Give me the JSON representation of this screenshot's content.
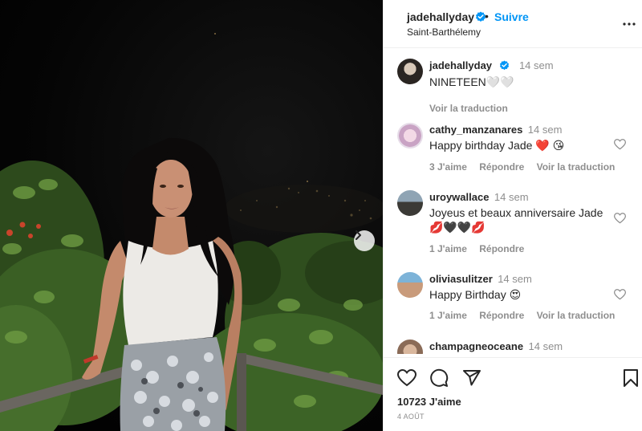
{
  "post": {
    "author": "jadehallyday",
    "follow_label": "Suivre",
    "separator": "•",
    "location": "Saint-Barthélemy",
    "likes": "10723 J'aime",
    "date": "4 AOÛT"
  },
  "caption": {
    "user": "jadehallyday",
    "time": "14 sem",
    "text": "NINETEEN🤍🤍",
    "see_translation": "Voir la traduction"
  },
  "comments": [
    {
      "user": "cathy_manzanares",
      "time": "14 sem",
      "text": "Happy birthday Jade ❤️ 😘",
      "text_line2": "",
      "likes": "3 J'aime",
      "reply": "Répondre",
      "translate": "Voir la traduction"
    },
    {
      "user": "uroywallace",
      "time": "14 sem",
      "text": "Joyeus et beaux anniversaire Jade",
      "text_line2": "💋🖤🖤💋",
      "likes": "1 J'aime",
      "reply": "Répondre",
      "translate": ""
    },
    {
      "user": "oliviasulitzer",
      "time": "14 sem",
      "text": "Happy Birthday 😍",
      "text_line2": "",
      "likes": "1 J'aime",
      "reply": "Répondre",
      "translate": "Voir la traduction"
    },
    {
      "user": "champagneoceane",
      "time": "14 sem",
      "text": "",
      "text_line2": "",
      "likes": "",
      "reply": "",
      "translate": ""
    }
  ],
  "icons": {
    "verified": "verified-badge-icon",
    "more": "more-options-icon",
    "next": "chevron-right-icon",
    "like": "heart-icon",
    "comment": "comment-icon",
    "share": "share-icon",
    "save": "bookmark-icon"
  },
  "colors": {
    "accent": "#0095f6",
    "text": "#262626",
    "muted": "#8e8e8e",
    "heart_red": "#ed4956"
  }
}
